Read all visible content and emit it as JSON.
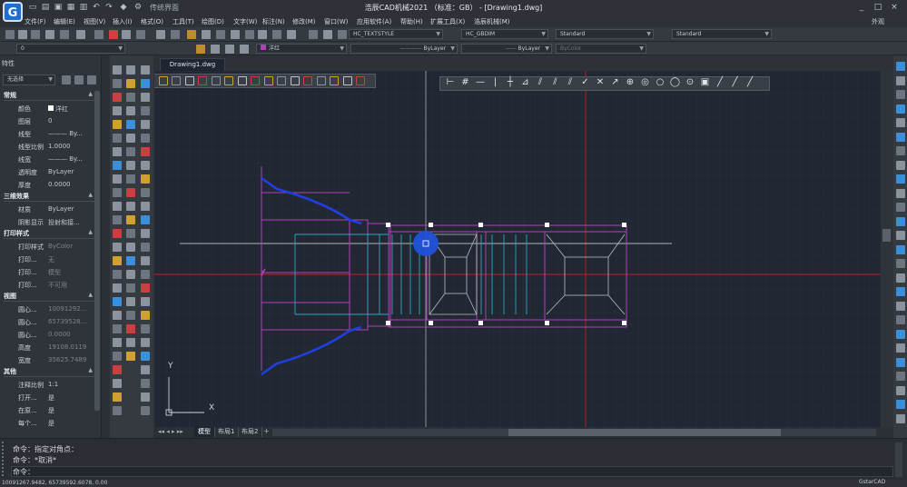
{
  "app": {
    "logo_letter": "G",
    "workspace": "传统界面",
    "window_title": "浩辰CAD机械2021 （标准：GB） - [Drawing1.dwg]",
    "window_buttons": [
      "_",
      "□",
      "×"
    ],
    "brand": "GstarCAD"
  },
  "menu": [
    "文件(F)",
    "编辑(E)",
    "视图(V)",
    "插入(I)",
    "格式(O)",
    "工具(T)",
    "绘图(D)",
    "文字(W)",
    "标注(N)",
    "修改(M)",
    "窗口(W)",
    "应用软件(A)",
    "帮助(H)",
    "扩展工具(X)",
    "浩辰机械(M)"
  ],
  "appearance_label": "外观",
  "toolbar": {
    "color_value": "洋红",
    "text_style": "HC_TEXTSTYLE",
    "dim_style": "HC_GBDIM",
    "table_style": "Standard",
    "multileader_style": "Standard",
    "linetype": "ByLayer",
    "lineweight": "ByLayer",
    "plot_style": "ByColor",
    "layer": "0"
  },
  "properties": {
    "panel_title": "特性",
    "selection": "无选择",
    "sections": [
      {
        "title": "常规",
        "rows": [
          {
            "key": "颜色",
            "value": "洋红",
            "swatch": "#ffffff"
          },
          {
            "key": "图层",
            "value": "0"
          },
          {
            "key": "线型",
            "value": "——— By..."
          },
          {
            "key": "线型比例",
            "value": "1.0000"
          },
          {
            "key": "线宽",
            "value": "——— By..."
          },
          {
            "key": "透明度",
            "value": "ByLayer"
          },
          {
            "key": "厚度",
            "value": "0.0000"
          }
        ]
      },
      {
        "title": "三维效果",
        "rows": [
          {
            "key": "材质",
            "value": "ByLayer"
          },
          {
            "key": "阴影显示",
            "value": "投射和接..."
          }
        ]
      },
      {
        "title": "打印样式",
        "rows": [
          {
            "key": "打印样式",
            "value": "ByColor",
            "dim": true
          },
          {
            "key": "打印...",
            "value": "无",
            "dim": true
          },
          {
            "key": "打印...",
            "value": "模型",
            "dim": true
          },
          {
            "key": "打印...",
            "value": "不可用",
            "dim": true
          }
        ]
      },
      {
        "title": "视图",
        "rows": [
          {
            "key": "圆心...",
            "value": "10091292...",
            "dim": true
          },
          {
            "key": "圆心...",
            "value": "65739528...",
            "dim": true
          },
          {
            "key": "圆心...",
            "value": "0.0000",
            "dim": true
          },
          {
            "key": "高度",
            "value": "19108.0119",
            "dim": true
          },
          {
            "key": "宽度",
            "value": "35625.7489",
            "dim": true
          }
        ]
      },
      {
        "title": "其他",
        "rows": [
          {
            "key": "注释比例",
            "value": "1:1"
          },
          {
            "key": "打开...",
            "value": "是"
          },
          {
            "key": "在原...",
            "value": "是"
          },
          {
            "key": "每个...",
            "value": "是"
          }
        ]
      }
    ]
  },
  "document": {
    "tab": "Drawing1.dwg",
    "layout_tabs": [
      "模型",
      "布局1",
      "布局2"
    ],
    "ucs_x": "X",
    "ucs_y": "Y"
  },
  "command": {
    "lines": [
      "命令：指定对角点：",
      "命令：*取消*",
      "命令："
    ]
  },
  "status": {
    "coords": "10091267.9482, 65739592.6078, 0.00"
  },
  "colors": {
    "canvas": "#212833",
    "crosshair_red": "#c0202a",
    "outline_magenta": "#b040b8",
    "inner_cyan": "#2aa8c0",
    "curve_blue": "#1f3fe0",
    "selection_blue": "#1f52d8"
  }
}
